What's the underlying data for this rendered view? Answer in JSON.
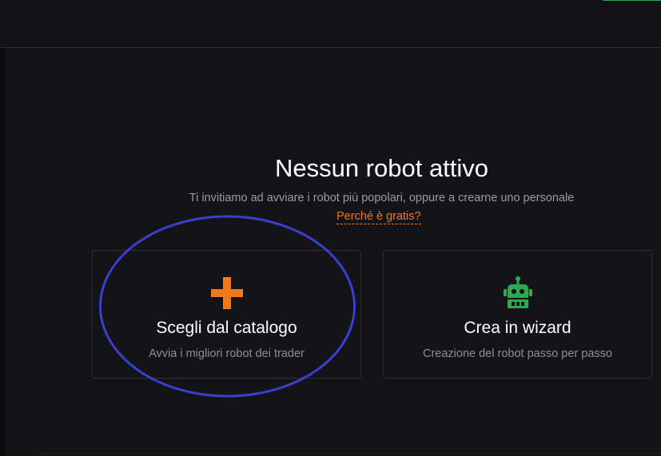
{
  "empty_state": {
    "title": "Nessun robot attivo",
    "subtitle": "Ti invitiamo ad avviare i robot più popolari, oppure a crearne uno personale",
    "why_link": "Perché è gratis?"
  },
  "cards": {
    "catalog": {
      "icon": "plus-icon",
      "title": "Scegli dal catalogo",
      "description": "Avvia i migliori robot dei trader"
    },
    "wizard": {
      "icon": "robot-icon",
      "title": "Crea in wizard",
      "description": "Creazione del robot passo per passo"
    }
  },
  "colors": {
    "background": "#131318",
    "accent_orange": "#f07a1a",
    "accent_green": "#2fa84f",
    "annotation_blue": "#3a3fd0"
  }
}
